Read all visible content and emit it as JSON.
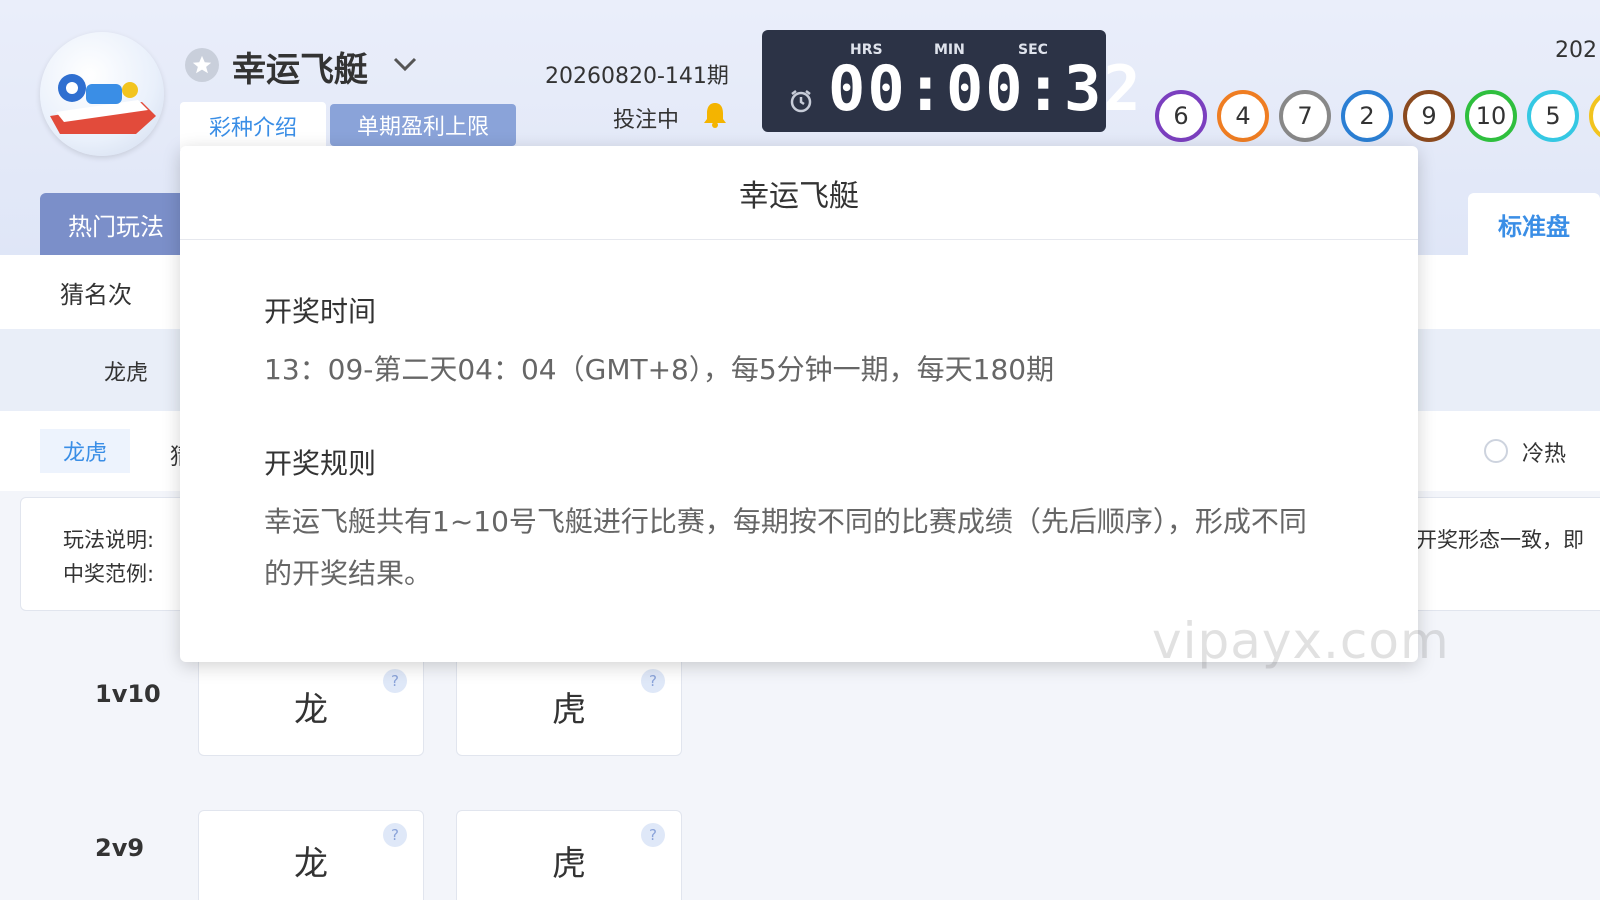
{
  "header": {
    "lottery_name": "幸运飞艇",
    "tabs": {
      "intro": "彩种介绍",
      "profit_limit": "单期盈利上限"
    },
    "issue_no": "20260820-141期",
    "bet_status": "投注中",
    "year_fragment": "202",
    "timer": {
      "hrs_label": "HRS",
      "min_label": "MIN",
      "sec_label": "SEC",
      "value": "00:00:32"
    }
  },
  "results": {
    "balls": [
      {
        "number": "6",
        "color": "#7b3fbf"
      },
      {
        "number": "4",
        "color": "#ef7d22"
      },
      {
        "number": "7",
        "color": "#888888"
      },
      {
        "number": "2",
        "color": "#2b7fd4"
      },
      {
        "number": "9",
        "color": "#8b4a1f"
      },
      {
        "number": "10",
        "color": "#2fbf3e"
      },
      {
        "number": "5",
        "color": "#35c8e3"
      },
      {
        "number": "",
        "color": "#f2c41f"
      }
    ]
  },
  "nav": {
    "hot_play": "热门玩法",
    "standard": "标准盘"
  },
  "play": {
    "guess_rank": "猜名次",
    "longhu": "龙虎",
    "subtab_active": "龙虎",
    "subtab_fragment": "猜",
    "coldhot": "冷热",
    "info_label_1": "玩法说明:",
    "info_label_2": "中奖范例:",
    "info_fragment": "开奖形态一致，即"
  },
  "bets": [
    {
      "match": "1v10",
      "dragon": "龙",
      "tiger": "虎",
      "help": "?"
    },
    {
      "match": "2v9",
      "dragon": "龙",
      "tiger": "虎",
      "help": "?"
    }
  ],
  "popup": {
    "title": "幸运飞艇",
    "time_title": "开奖时间",
    "time_text": "13：09-第二天04：04（GMT+8），每5分钟一期，每天180期",
    "rule_title": "开奖规则",
    "rule_text": "幸运飞艇共有1~10号飞艇进行比赛，每期按不同的比赛成绩（先后顺序），形成不同的开奖结果。"
  },
  "watermark": "vipayx.com"
}
